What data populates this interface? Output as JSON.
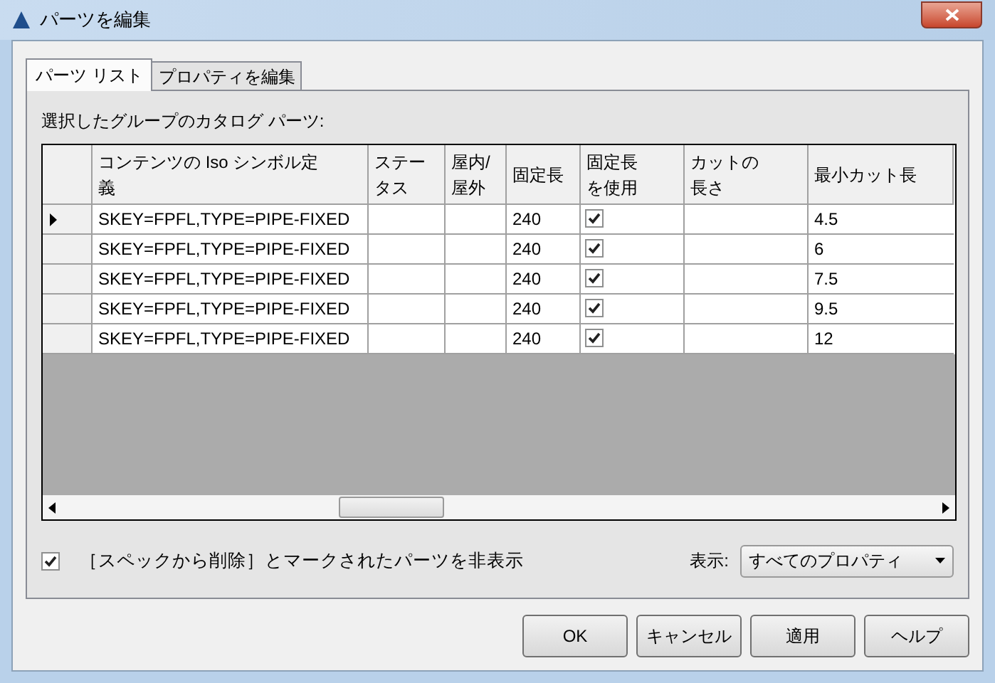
{
  "window": {
    "title": "パーツを編集"
  },
  "tabs": [
    {
      "label": "パーツ リスト",
      "selected": true
    },
    {
      "label": "プロパティを編集",
      "selected": false
    }
  ],
  "section_label": "選択したグループのカタログ パーツ:",
  "table": {
    "columns": [
      "コンテンツの Iso シンボル定義",
      "ステータス",
      "屋内/屋外",
      "固定長",
      "固定長を使用",
      "カットの長さ",
      "最小カット長"
    ],
    "rows": [
      {
        "selected": true,
        "definition": "SKEY=FPFL,TYPE=PIPE-FIXED",
        "fixed_length": "240",
        "use_fixed_length": true,
        "min_cut_length": "4.5"
      },
      {
        "selected": false,
        "definition": "SKEY=FPFL,TYPE=PIPE-FIXED",
        "fixed_length": "240",
        "use_fixed_length": true,
        "min_cut_length": "6"
      },
      {
        "selected": false,
        "definition": "SKEY=FPFL,TYPE=PIPE-FIXED",
        "fixed_length": "240",
        "use_fixed_length": true,
        "min_cut_length": "7.5"
      },
      {
        "selected": false,
        "definition": "SKEY=FPFL,TYPE=PIPE-FIXED",
        "fixed_length": "240",
        "use_fixed_length": true,
        "min_cut_length": "9.5"
      },
      {
        "selected": false,
        "definition": "SKEY=FPFL,TYPE=PIPE-FIXED",
        "fixed_length": "240",
        "use_fixed_length": true,
        "min_cut_length": "12"
      }
    ]
  },
  "hide_deleted": {
    "label": "［スペックから削除］とマークされたパーツを非表示",
    "checked": true
  },
  "display": {
    "label": "表示:",
    "value": "すべてのプロパティ"
  },
  "buttons": [
    "OK",
    "キャンセル",
    "適用",
    "ヘルプ"
  ]
}
